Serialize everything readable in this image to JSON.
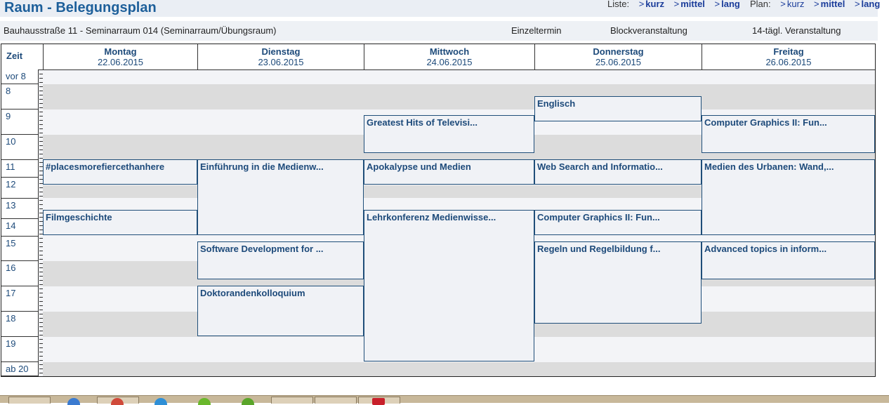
{
  "header": {
    "title": "Raum - Belegungsplan",
    "liste_label": "Liste:",
    "liste_kurz": "kurz",
    "liste_mittel": "mittel",
    "liste_lang": "lang",
    "plan_label": "Plan:",
    "plan_kurz": "kurz",
    "plan_mittel": "mittel",
    "plan_lang": "lang",
    "arrow": ">"
  },
  "subbar": {
    "room": "Bauhausstraße 11 - Seminarraum 014 (Seminarraum/Übungsraum)",
    "einzeltermin": "Einzeltermin",
    "block": "Blockveranstaltung",
    "biweekly": "14-tägl. Veranstaltung"
  },
  "grid": {
    "zeit_label": "Zeit",
    "days": [
      {
        "name": "Montag",
        "date": "22.06.2015"
      },
      {
        "name": "Dienstag",
        "date": "23.06.2015"
      },
      {
        "name": "Mittwoch",
        "date": "24.06.2015"
      },
      {
        "name": "Donnerstag",
        "date": "25.06.2015"
      },
      {
        "name": "Freitag",
        "date": "26.06.2015"
      }
    ],
    "times": [
      "vor 8",
      "8",
      "9",
      "10",
      "11",
      "12",
      "13",
      "14",
      "15",
      "16",
      "17",
      "18",
      "19",
      "ab 20"
    ]
  },
  "events": {
    "englisch": "Englisch",
    "greatest_hits": "Greatest Hits of Televisi...",
    "cg2_fr": "Computer Graphics II: Fun...",
    "places": "#placesmorefiercethanhere",
    "einfuehrung": "Einführung in die Medienw...",
    "apokalypse": "Apokalypse und Medien",
    "websearch": "Web Search and Informatio...",
    "urbanen": "Medien des Urbanen: Wand,...",
    "filmgeschichte": "Filmgeschichte",
    "lehrkonferenz": "Lehrkonferenz Medienwisse...",
    "cg2_do": "Computer Graphics II: Fun...",
    "software": "Software Development for ...",
    "regeln": "Regeln und Regelbildung f...",
    "advanced": "Advanced topics in inform...",
    "doktoranden": "Doktorandenkolloquium"
  }
}
